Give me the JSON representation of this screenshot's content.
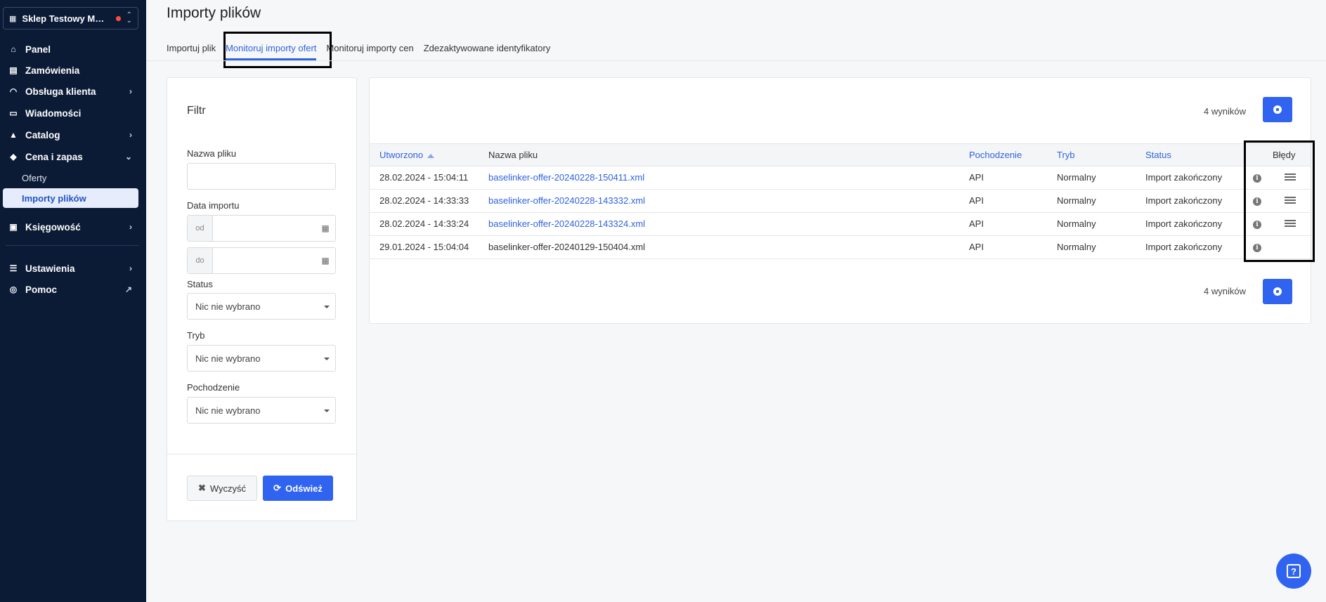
{
  "sidebar": {
    "store_name": "Sklep Testowy MOD ...",
    "items": [
      {
        "label": "Panel",
        "icon": "home-icon"
      },
      {
        "label": "Zamówienia",
        "icon": "clipboard-icon"
      },
      {
        "label": "Obsługa klienta",
        "icon": "headset-icon"
      },
      {
        "label": "Wiadomości",
        "icon": "message-icon"
      },
      {
        "label": "Catalog",
        "icon": "catalog-icon"
      },
      {
        "label": "Cena i zapas",
        "icon": "tag-icon"
      },
      {
        "label": "Księgowość",
        "icon": "accounting-icon"
      },
      {
        "label": "Ustawienia",
        "icon": "sliders-icon"
      },
      {
        "label": "Pomoc",
        "icon": "lifebuoy-icon"
      }
    ],
    "sub_items": [
      {
        "label": "Oferty"
      },
      {
        "label": "Importy plików"
      }
    ]
  },
  "page": {
    "title": "Importy plików",
    "tabs": [
      {
        "label": "Importuj plik"
      },
      {
        "label": "Monitoruj importy ofert"
      },
      {
        "label": "Monitoruj importy cen"
      },
      {
        "label": "Zdezaktywowane identyfikatory"
      }
    ]
  },
  "filter": {
    "title": "Filtr",
    "file_name_label": "Nazwa pliku",
    "import_date_label": "Data importu",
    "from_prefix": "od",
    "to_prefix": "do",
    "status_label": "Status",
    "status_value": "Nic nie wybrano",
    "mode_label": "Tryb",
    "mode_value": "Nic nie wybrano",
    "origin_label": "Pochodzenie",
    "origin_value": "Nic nie wybrano",
    "clear_label": "Wyczyść",
    "refresh_label": "Odśwież"
  },
  "results": {
    "count_label": "4 wyników",
    "columns": {
      "created": "Utworzono",
      "file_name": "Nazwa pliku",
      "origin": "Pochodzenie",
      "mode": "Tryb",
      "status": "Status",
      "errors": "Błędy"
    },
    "rows": [
      {
        "created": "28.02.2024 - 15:04:11",
        "file": "baselinker-offer-20240228-150411.xml",
        "origin": "API",
        "mode": "Normalny",
        "status": "Import zakończony"
      },
      {
        "created": "28.02.2024 - 14:33:33",
        "file": "baselinker-offer-20240228-143332.xml",
        "origin": "API",
        "mode": "Normalny",
        "status": "Import zakończony"
      },
      {
        "created": "28.02.2024 - 14:33:24",
        "file": "baselinker-offer-20240228-143324.xml",
        "origin": "API",
        "mode": "Normalny",
        "status": "Import zakończony"
      },
      {
        "created": "29.01.2024 - 15:04:04",
        "file": "baselinker-offer-20240129-150404.xml",
        "origin": "API",
        "mode": "Normalny",
        "status": "Import zakończony"
      }
    ]
  },
  "colors": {
    "sidebar_bg": "#0b1b36",
    "accent": "#2f63f0",
    "link": "#2f63e0"
  }
}
